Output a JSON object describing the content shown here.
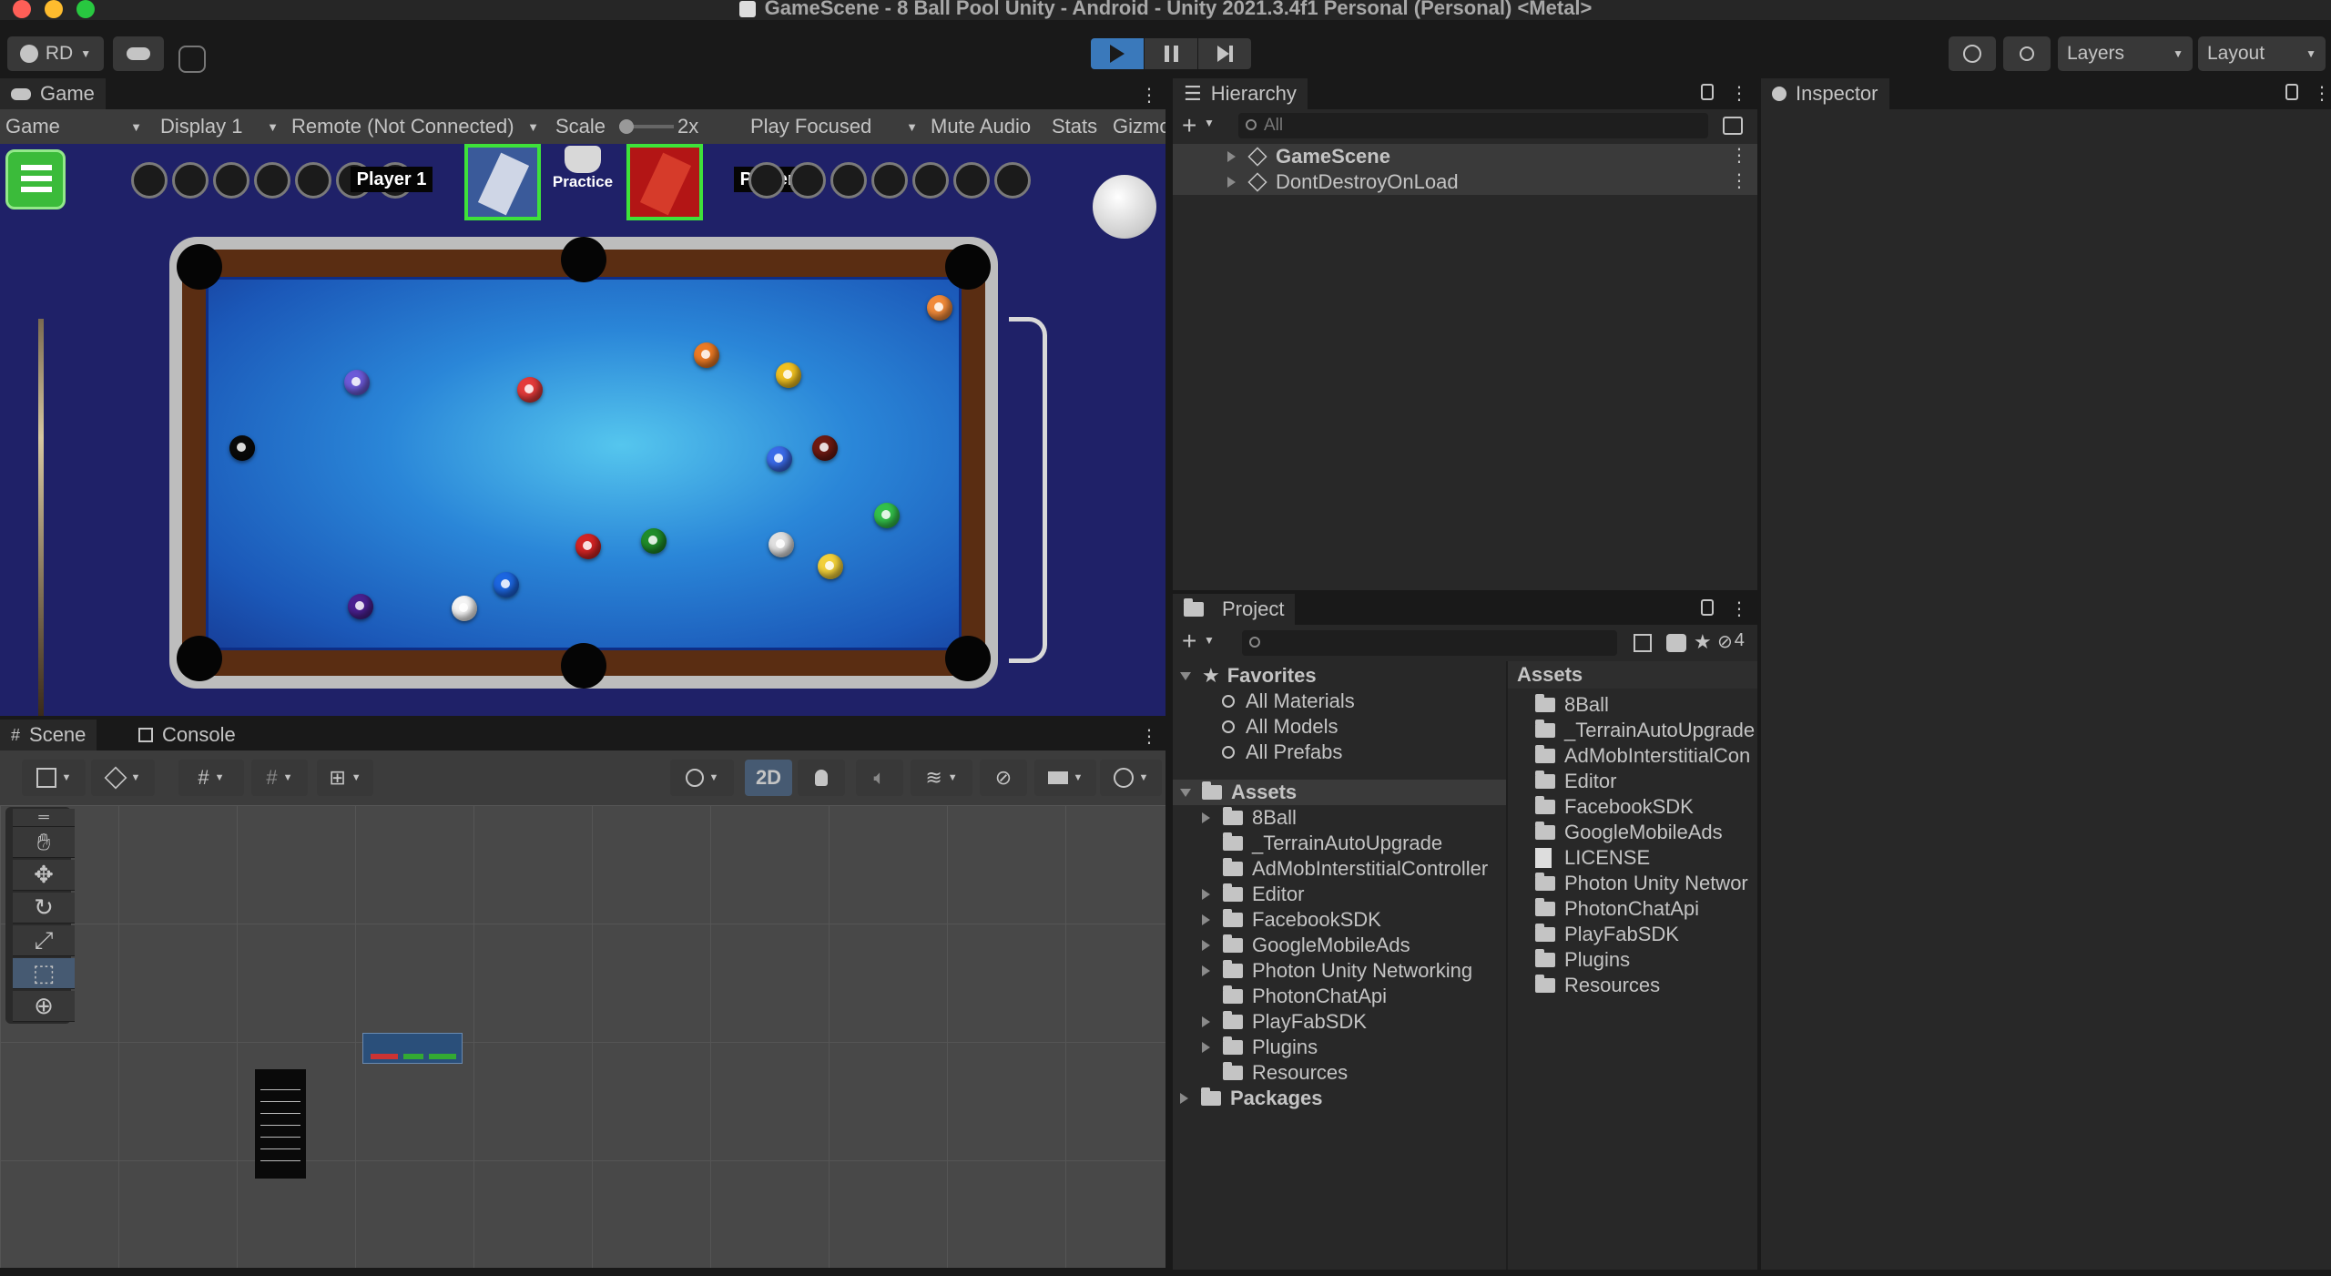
{
  "window": {
    "title": "GameScene - 8 Ball Pool Unity - Android - Unity 2021.3.4f1 Personal (Personal) <Metal>"
  },
  "toolbar": {
    "account": "RD",
    "layers": "Layers",
    "layout": "Layout"
  },
  "game": {
    "tab": "Game",
    "mode": "Game",
    "display": "Display 1",
    "remote": "Remote (Not Connected)",
    "scale_label": "Scale",
    "scale_value": "2x",
    "play_focused": "Play Focused",
    "mute_audio": "Mute Audio",
    "stats": "Stats",
    "gizmos": "Gizmc",
    "hud": {
      "player1": "Player 1",
      "player2": "Player 2",
      "practice": "Practice"
    }
  },
  "scene": {
    "tab_scene": "Scene",
    "tab_console": "Console",
    "mode_2d": "2D"
  },
  "hierarchy": {
    "tab": "Hierarchy",
    "search_placeholder": "All",
    "items": [
      {
        "label": "GameScene"
      },
      {
        "label": "DontDestroyOnLoad"
      }
    ]
  },
  "inspector": {
    "tab": "Inspector"
  },
  "project": {
    "tab": "Project",
    "hidden_count": "4",
    "favorites": {
      "label": "Favorites",
      "items": [
        "All Materials",
        "All Models",
        "All Prefabs"
      ]
    },
    "tree": {
      "root": "Assets",
      "items": [
        {
          "label": "8Ball",
          "expandable": true
        },
        {
          "label": "_TerrainAutoUpgrade",
          "expandable": false
        },
        {
          "label": "AdMobInterstitialController",
          "expandable": false
        },
        {
          "label": "Editor",
          "expandable": true
        },
        {
          "label": "FacebookSDK",
          "expandable": true
        },
        {
          "label": "GoogleMobileAds",
          "expandable": true
        },
        {
          "label": "Photon Unity Networking",
          "expandable": true
        },
        {
          "label": "PhotonChatApi",
          "expandable": false
        },
        {
          "label": "PlayFabSDK",
          "expandable": true
        },
        {
          "label": "Plugins",
          "expandable": true
        },
        {
          "label": "Resources",
          "expandable": false
        }
      ],
      "packages": "Packages"
    },
    "assets_header": "Assets",
    "assets": [
      {
        "label": "8Ball",
        "type": "folder"
      },
      {
        "label": "_TerrainAutoUpgrade",
        "type": "folder"
      },
      {
        "label": "AdMobInterstitialCon",
        "type": "folder"
      },
      {
        "label": "Editor",
        "type": "folder"
      },
      {
        "label": "FacebookSDK",
        "type": "folder"
      },
      {
        "label": "GoogleMobileAds",
        "type": "folder"
      },
      {
        "label": "LICENSE",
        "type": "file"
      },
      {
        "label": "Photon Unity Networ",
        "type": "folder"
      },
      {
        "label": "PhotonChatApi",
        "type": "folder"
      },
      {
        "label": "PlayFabSDK",
        "type": "folder"
      },
      {
        "label": "Plugins",
        "type": "folder"
      },
      {
        "label": "Resources",
        "type": "folder"
      }
    ]
  },
  "colors": {
    "accent": "#3a79bb",
    "felt": "#1f6fc8",
    "rail": "#5a2d12"
  }
}
